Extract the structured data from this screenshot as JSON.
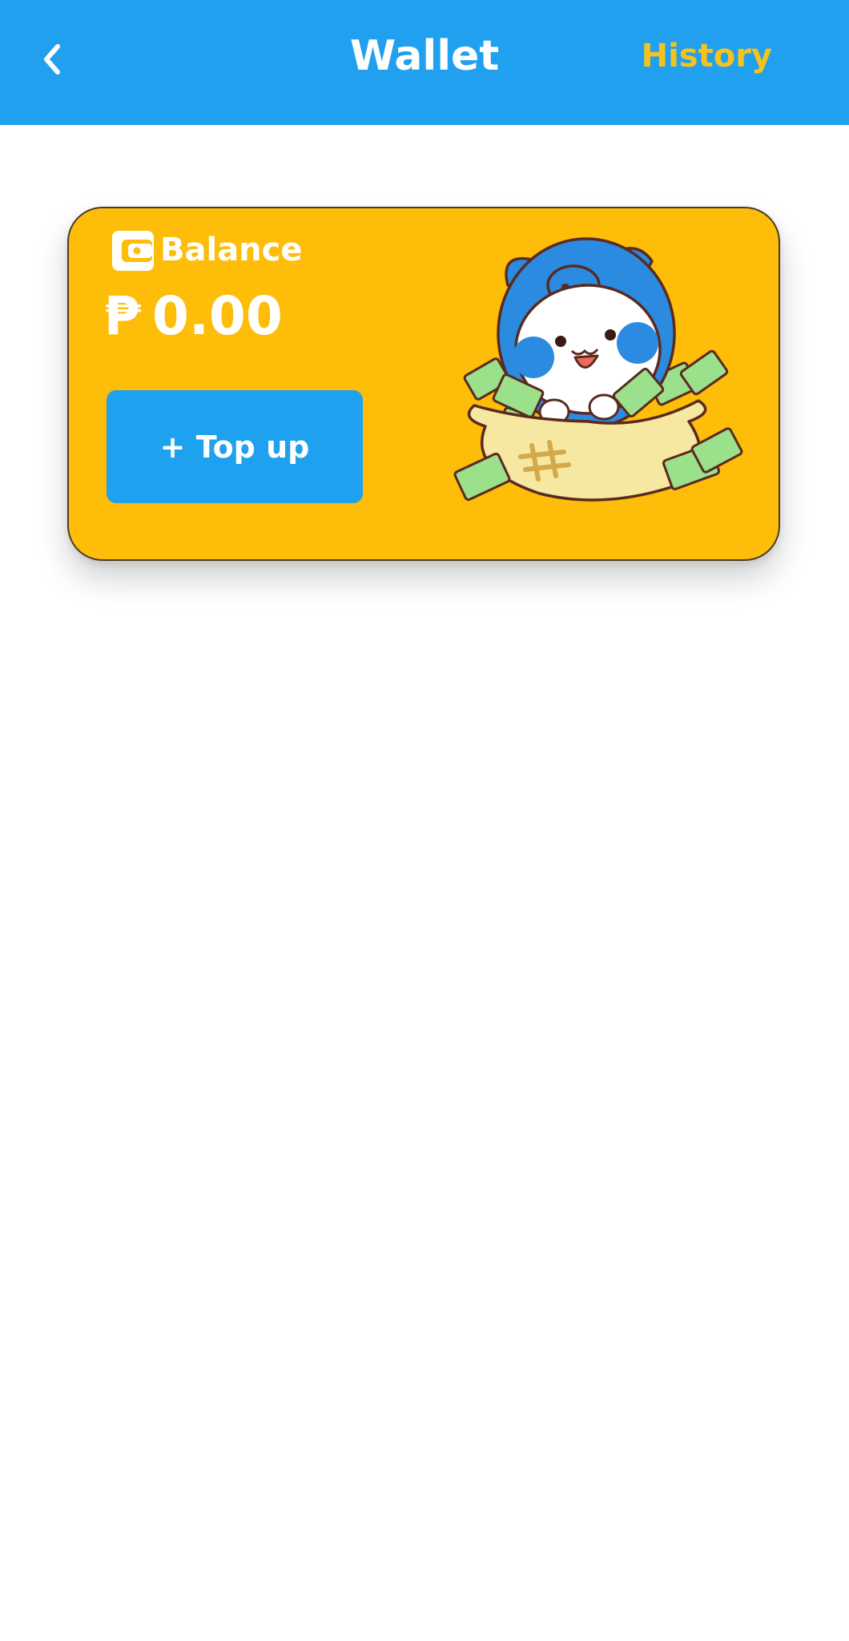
{
  "header": {
    "back_icon": "chevron-left-icon",
    "title": "Wallet",
    "history_label": "History"
  },
  "balance_card": {
    "icon": "wallet-icon",
    "label": "Balance",
    "currency_symbol": "₱",
    "amount": "0.00",
    "topup_label": "+ Top up",
    "illustration": "mascot-money-bag"
  },
  "colors": {
    "header_bg": "#20a0ee",
    "history_text": "#f5c31c",
    "card_bg": "#fdbd08",
    "button_bg": "#1ea1ee",
    "page_bg": "#ffffff"
  }
}
